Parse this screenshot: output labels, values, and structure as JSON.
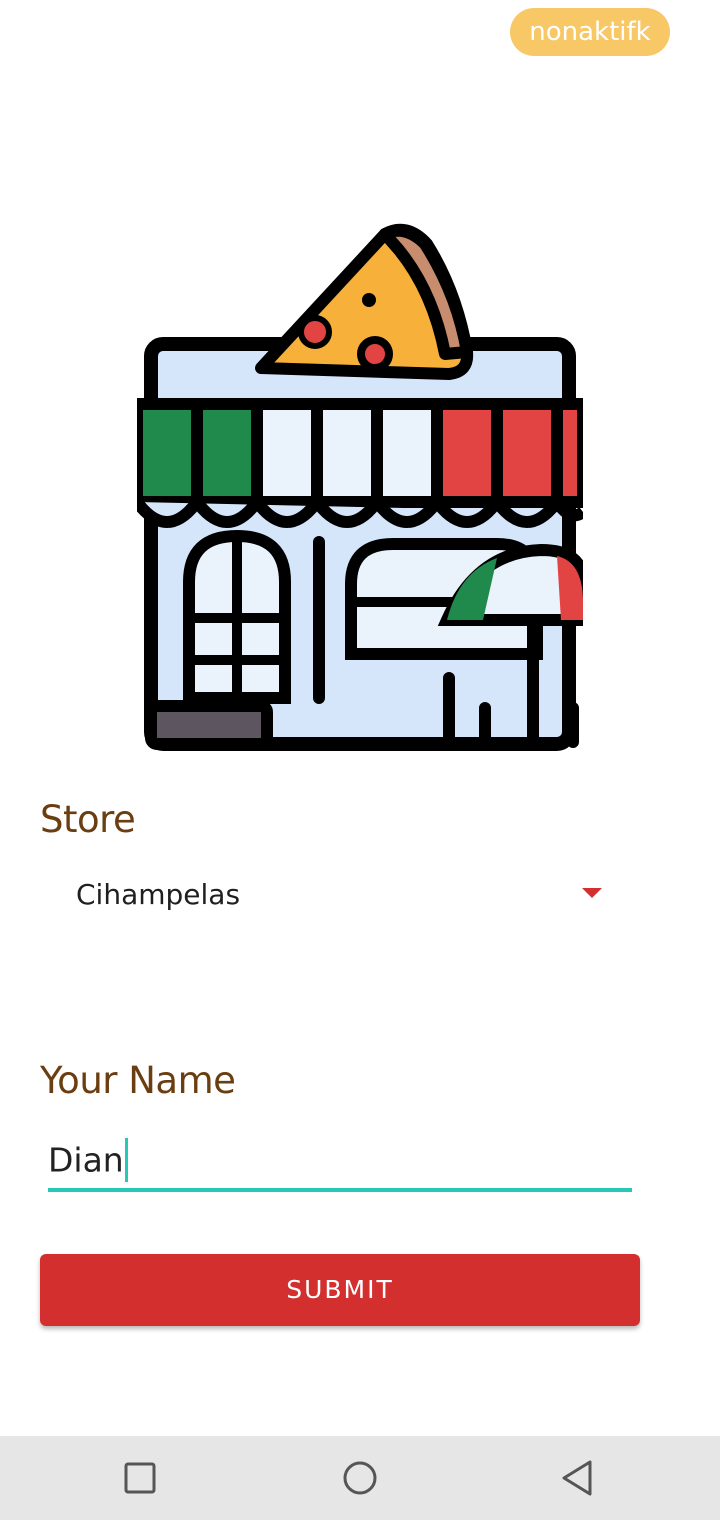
{
  "header": {
    "status_badge": "nonaktifk"
  },
  "logo": {
    "icon": "pizza-store-icon"
  },
  "form": {
    "store_label": "Store",
    "store_selected": "Cihampelas",
    "name_label": "Your Name",
    "name_value": "Dian",
    "submit_label": "SUBMIT"
  },
  "navbar": {
    "icons": [
      "recent-apps-icon",
      "home-icon",
      "back-icon"
    ]
  },
  "colors": {
    "badge": "#f9c866",
    "label": "#6b3e12",
    "accent": "#26c9b8",
    "primary": "#d32f2f"
  }
}
